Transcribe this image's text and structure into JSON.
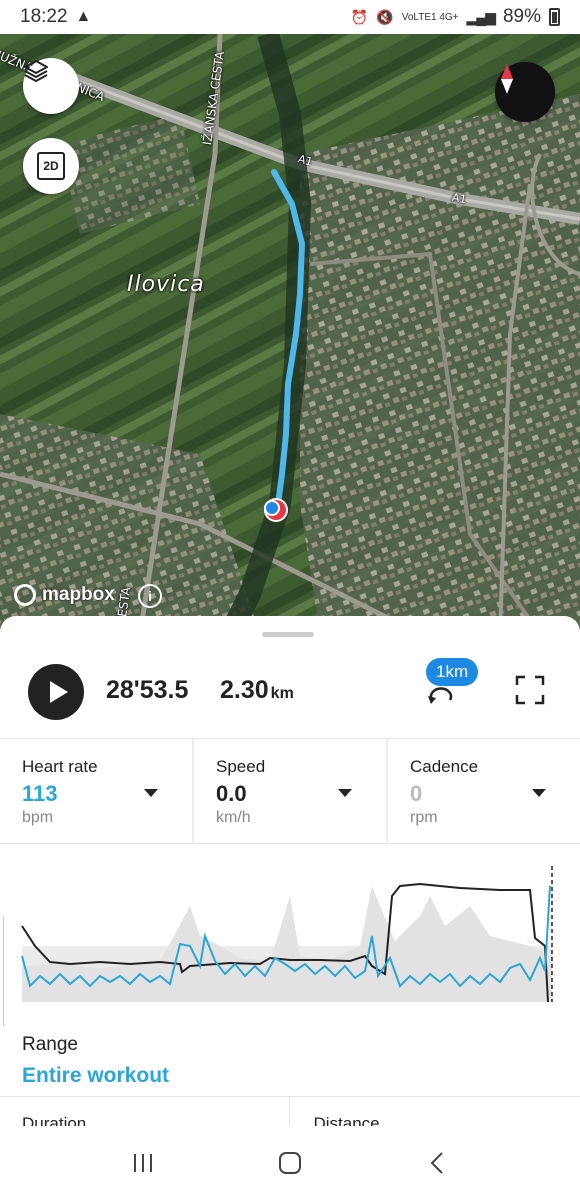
{
  "status_bar": {
    "time": "18:22",
    "network_label": "VoLTE1 4G+",
    "battery": "89%"
  },
  "map": {
    "place_label": "Ilovica",
    "road_labels": [
      "JUŽNA OBILAZNICA",
      "IŽANSKA CESTA",
      "A1",
      "A1",
      "CESTA"
    ],
    "attribution": "mapbox",
    "buttons": {
      "layers": "layers-icon",
      "view_mode": "2D",
      "compass": "compass-icon"
    },
    "route_color": "#4fb8ea"
  },
  "playback": {
    "elapsed": "28'53.5",
    "distance": "2.30",
    "distance_unit": "km",
    "lap_badge": "1km"
  },
  "metrics": [
    {
      "label": "Heart rate",
      "value": "113",
      "unit": "bpm",
      "value_color": "#2ba6d9"
    },
    {
      "label": "Speed",
      "value": "0.0",
      "unit": "km/h",
      "value_color": "#222222"
    },
    {
      "label": "Cadence",
      "value": "0",
      "unit": "rpm",
      "value_color": "#bbbbbb"
    }
  ],
  "graph": {
    "series": [
      {
        "name": "Heart rate",
        "color": "#2ba6d9"
      },
      {
        "name": "Speed",
        "color": "#222222"
      }
    ]
  },
  "range": {
    "label": "Range",
    "value": "Entire workout"
  },
  "summary": {
    "left_label": "Duration",
    "right_label": "Distance"
  }
}
